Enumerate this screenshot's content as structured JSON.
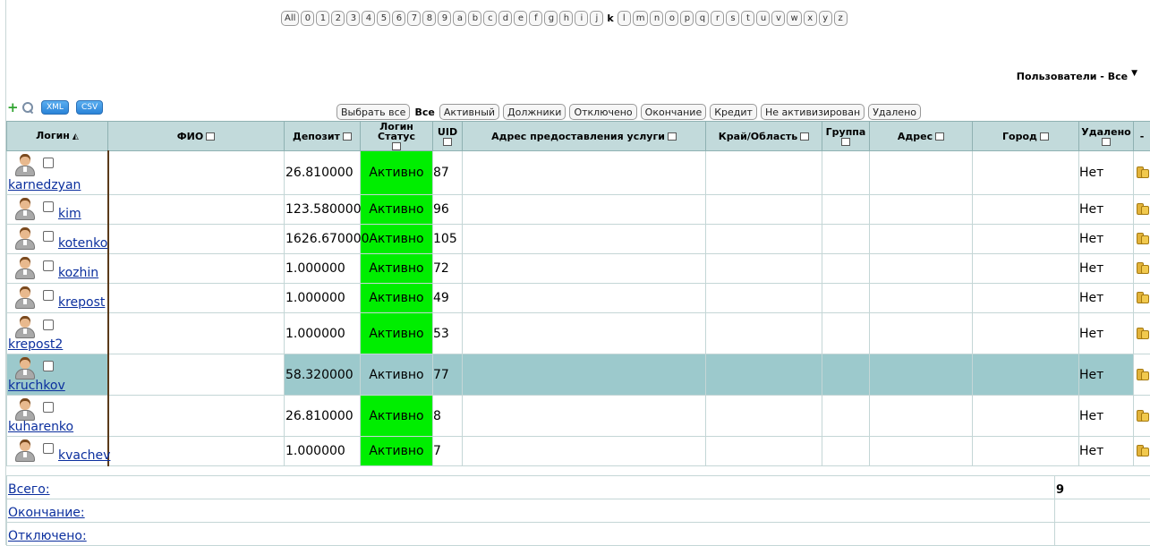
{
  "letters": [
    "All",
    "0",
    "1",
    "2",
    "3",
    "4",
    "5",
    "6",
    "7",
    "8",
    "9",
    "a",
    "b",
    "c",
    "d",
    "e",
    "f",
    "g",
    "h",
    "i",
    "j",
    "k",
    "l",
    "m",
    "n",
    "o",
    "p",
    "q",
    "r",
    "s",
    "t",
    "u",
    "v",
    "w",
    "x",
    "y",
    "z"
  ],
  "active_letter": "k",
  "users_menu": {
    "label": "Пользователи - Все"
  },
  "toolbar": {
    "xml_label": "XML",
    "csv_label": "CSV"
  },
  "filters": {
    "select_all": "Выбрать все",
    "all": "Все",
    "active": "Активный",
    "debtors": "Должники",
    "disabled": "Отключено",
    "expired": "Окончание",
    "credit": "Кредит",
    "not_activated": "Не активизирован",
    "deleted": "Удалено"
  },
  "columns": {
    "login": "Логин",
    "fio": "ФИО",
    "deposit": "Депозит",
    "login_status": "Логин Статус",
    "uid": "UID",
    "service_address": "Адрес предоставления услуги",
    "region": "Край/Область",
    "group": "Группа",
    "address": "Адрес",
    "city": "Город",
    "deleted": "Удалено",
    "dash": "-"
  },
  "rows": [
    {
      "login": "karnedzyan",
      "deposit": "26.810000",
      "status": "Активно",
      "uid": "87",
      "deleted": "Нет",
      "wrap": true,
      "height": 49,
      "selected": false
    },
    {
      "login": "kim",
      "deposit": "123.580000",
      "status": "Активно",
      "uid": "96",
      "deleted": "Нет",
      "wrap": false,
      "height": 33,
      "selected": false
    },
    {
      "login": "kotenko",
      "deposit": "1626.670000",
      "status": "Активно",
      "uid": "105",
      "deleted": "Нет",
      "wrap": false,
      "height": 33,
      "selected": false
    },
    {
      "login": "kozhin",
      "deposit": "1.000000",
      "status": "Активно",
      "uid": "72",
      "deleted": "Нет",
      "wrap": false,
      "height": 33,
      "selected": false
    },
    {
      "login": "krepost",
      "deposit": "1.000000",
      "status": "Активно",
      "uid": "49",
      "deleted": "Нет",
      "wrap": false,
      "height": 33,
      "selected": false
    },
    {
      "login": "krepost2",
      "deposit": "1.000000",
      "status": "Активно",
      "uid": "53",
      "deleted": "Нет",
      "wrap": true,
      "height": 46,
      "selected": false
    },
    {
      "login": "kruchkov",
      "deposit": "58.320000",
      "status": "Активно",
      "uid": "77",
      "deleted": "Нет",
      "wrap": true,
      "height": 46,
      "selected": true
    },
    {
      "login": "kuharenko",
      "deposit": "26.810000",
      "status": "Активно",
      "uid": "8",
      "deleted": "Нет",
      "wrap": true,
      "height": 46,
      "selected": false
    },
    {
      "login": "kvachev",
      "deposit": "1.000000",
      "status": "Активно",
      "uid": "7",
      "deleted": "Нет",
      "wrap": false,
      "height": 33,
      "selected": false
    }
  ],
  "summary": [
    {
      "label": "Всего:",
      "value": "9"
    },
    {
      "label": "Окончание:",
      "value": ""
    },
    {
      "label": "Отключено:",
      "value": ""
    }
  ],
  "colors": {
    "status_active": "#00ee00",
    "header_bg": "#c2dadb",
    "selected_row": "#9cc9cc",
    "link": "#0b2f9e"
  }
}
